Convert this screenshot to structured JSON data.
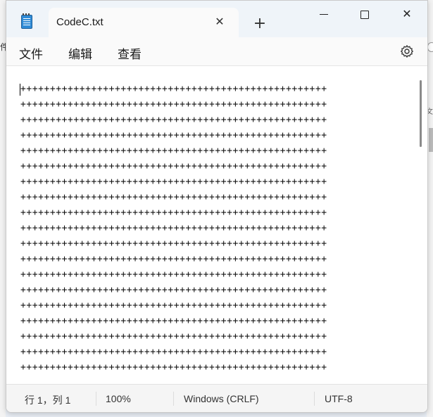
{
  "window": {
    "tab_title": "CodeC.txt",
    "new_tab_symbol": "+",
    "close_tab_symbol": "✕",
    "win_close_symbol": "✕"
  },
  "menu": {
    "file": "文件",
    "edit": "编辑",
    "view": "查看"
  },
  "editor": {
    "line_text": "++++++++++++++++++++++++++++++++++++++++++++++++++++",
    "visible_line_count": 19
  },
  "status": {
    "position": "行 1，列 1",
    "zoom": "100%",
    "line_ending": "Windows (CRLF)",
    "encoding": "UTF-8"
  },
  "background_strip": {
    "left_text": "件",
    "right_text": "文"
  },
  "icons": {
    "app": "notepad-icon",
    "settings": "gear-icon",
    "minimize": "minimize-icon",
    "maximize": "maximize-icon",
    "close": "close-icon"
  },
  "colors": {
    "titlebar_bg": "#eff4f9",
    "content_bg": "#ffffff",
    "statusbar_bg": "#f5f5f5"
  }
}
